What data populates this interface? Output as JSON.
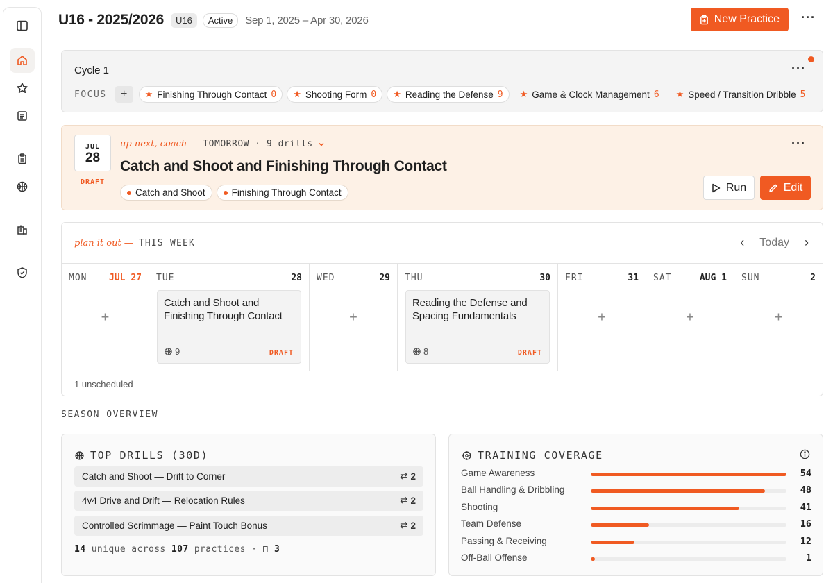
{
  "header": {
    "title": "U16 - 2025/2026",
    "badge": "U16",
    "status": "Active",
    "dates": "Sep 1, 2025 – Apr 30, 2026",
    "new_practice_label": "New Practice"
  },
  "cycle": {
    "title": "Cycle 1",
    "focus_label": "FOCUS",
    "focus_items": [
      {
        "label": "Finishing Through Contact",
        "count": "0"
      },
      {
        "label": "Shooting Form",
        "count": "0"
      },
      {
        "label": "Reading the Defense",
        "count": "9"
      },
      {
        "label": "Game & Clock Management",
        "count": "6"
      },
      {
        "label": "Speed / Transition Dribble",
        "count": "5"
      }
    ]
  },
  "next_practice": {
    "month": "JUL",
    "day": "28",
    "status": "DRAFT",
    "kicker": "up next, coach —",
    "when": "TOMORROW · 9 drills",
    "title": "Catch and Shoot and Finishing Through Contact",
    "tags": [
      "Catch and Shoot",
      "Finishing Through Contact"
    ],
    "run_label": "Run",
    "edit_label": "Edit"
  },
  "week": {
    "kicker": "plan it out —",
    "label": "THIS WEEK",
    "today_label": "Today",
    "days": [
      {
        "name": "MON",
        "date": "JUL 27",
        "today": true
      },
      {
        "name": "TUE",
        "date": "28",
        "practice": {
          "title": "Catch and Shoot and Finishing Through Contact",
          "drills": "9",
          "status": "DRAFT"
        }
      },
      {
        "name": "WED",
        "date": "29"
      },
      {
        "name": "THU",
        "date": "30",
        "practice": {
          "title": "Reading the Defense and Spacing Fundamentals",
          "drills": "8",
          "status": "DRAFT"
        }
      },
      {
        "name": "FRI",
        "date": "31"
      },
      {
        "name": "SAT",
        "date": "AUG 1"
      },
      {
        "name": "SUN",
        "date": "2"
      }
    ],
    "unscheduled": "1 unscheduled"
  },
  "season": {
    "label": "SEASON OVERVIEW",
    "top_drills": {
      "title": "TOP DRILLS (30D)",
      "items": [
        {
          "label": "Catch and Shoot — Drift to Corner",
          "count": "2"
        },
        {
          "label": "4v4 Drive and Drift — Relocation Rules",
          "count": "2"
        },
        {
          "label": "Controlled Scrimmage — Paint Touch Bonus",
          "count": "2"
        }
      ],
      "unique_count": "14",
      "unique_text": "unique across",
      "practice_count": "107",
      "practices_text": "practices ·",
      "bookmarks": "3"
    },
    "coverage": {
      "title": "TRAINING COVERAGE",
      "max": 54,
      "items": [
        {
          "label": "Game Awareness",
          "value": "54"
        },
        {
          "label": "Ball Handling & Dribbling",
          "value": "48"
        },
        {
          "label": "Shooting",
          "value": "41"
        },
        {
          "label": "Team Defense",
          "value": "16"
        },
        {
          "label": "Passing & Receiving",
          "value": "12"
        },
        {
          "label": "Off-Ball Offense",
          "value": "1"
        }
      ]
    }
  },
  "colors": {
    "accent": "#f05a22",
    "next_bg": "#fdf1e6"
  }
}
